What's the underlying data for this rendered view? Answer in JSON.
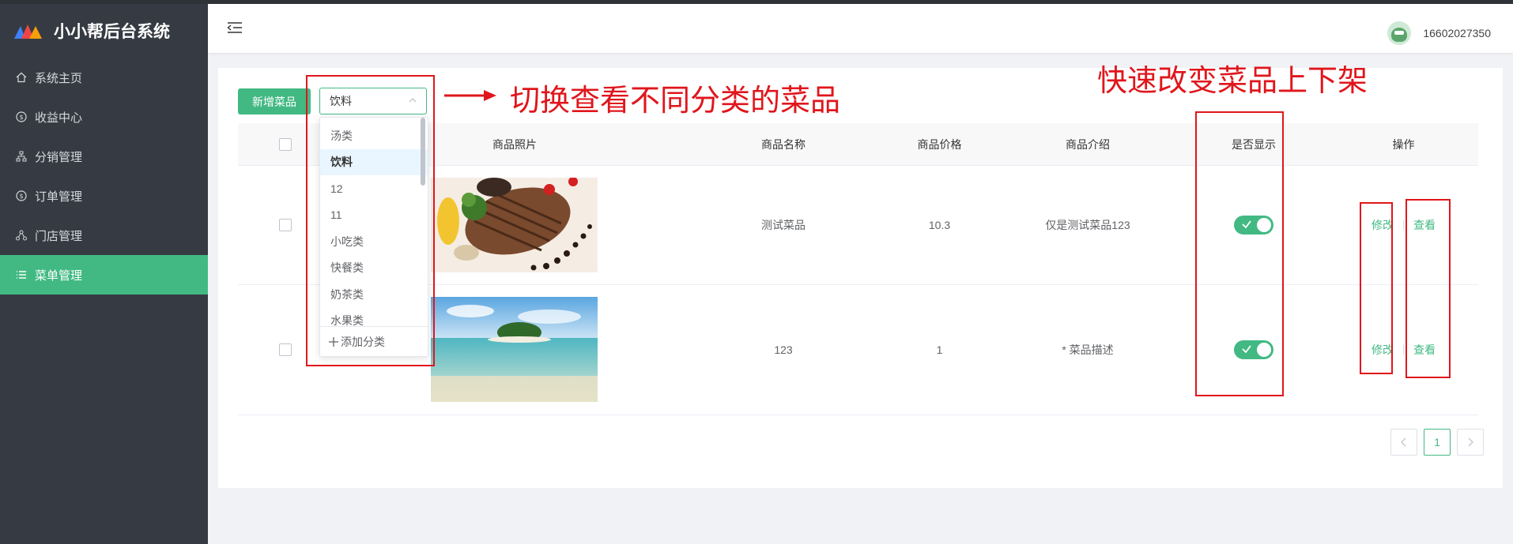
{
  "app": {
    "title": "小小帮后台系统",
    "brand_colors": [
      "#3b82f6",
      "#ef4444",
      "#f59e0b"
    ]
  },
  "sidebar": {
    "items": [
      {
        "label": "系统主页",
        "icon": "home-icon",
        "active": false
      },
      {
        "label": "收益中心",
        "icon": "dollar-circle-icon",
        "active": false
      },
      {
        "label": "分销管理",
        "icon": "sitemap-icon",
        "active": false
      },
      {
        "label": "订单管理",
        "icon": "dollar-circle-icon",
        "active": false
      },
      {
        "label": "门店管理",
        "icon": "network-icon",
        "active": false
      },
      {
        "label": "菜单管理",
        "icon": "list-icon",
        "active": true
      }
    ]
  },
  "header": {
    "menu_toggle_icon": "menu-fold-icon",
    "username": "16602027350"
  },
  "toolbar": {
    "add_label": "新增菜品",
    "category_select": {
      "value": "饮料",
      "options": [
        "汤类",
        "饮料",
        "12",
        "11",
        "小吃类",
        "快餐类",
        "奶茶类",
        "水果类"
      ],
      "add_category_label": "添加分类"
    }
  },
  "table": {
    "columns": [
      "商品照片",
      "商品名称",
      "商品价格",
      "商品介绍",
      "是否显示",
      "操作"
    ],
    "rows": [
      {
        "name": "测试菜品",
        "price": "10.3",
        "intro": "仅是测试菜品123",
        "visible": true,
        "photo": "grilled-steak-dish",
        "edit": "修改",
        "view": "查看"
      },
      {
        "name": "123",
        "price": "1",
        "intro": "* 菜品描述",
        "visible": true,
        "photo": "tropical-beach-island",
        "edit": "修改",
        "view": "查看"
      }
    ]
  },
  "pagination": {
    "current_page": "1",
    "prev": "<",
    "next": ">"
  },
  "annotations": {
    "switch_category": "切换查看不同分类的菜品",
    "toggle_shelf": "快速改变菜品上下架",
    "color": "#e0161c"
  },
  "theme": {
    "accent": "#42b983",
    "sidebar_bg": "#363b43"
  }
}
